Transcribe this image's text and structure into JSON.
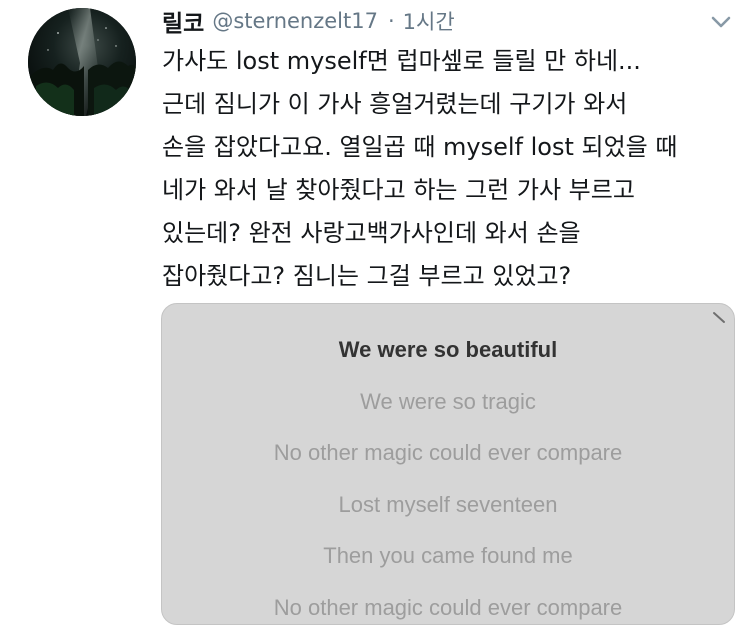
{
  "tweet": {
    "display_name": "릴코",
    "handle": "@sternenzelt17",
    "separator": "·",
    "time": "1시간",
    "lines": [
      "가사도 lost myself면 럽마셒로 들릴 만 하네...",
      "근데 짐니가 이 가사 흥얼거렸는데 구기가 와서",
      "손을 잡았다고요. 열일곱 때 myself lost 되었을 때",
      "네가 와서 날 찾아줬다고 하는 그런 가사 부르고",
      "있는데? 완전 사랑고백가사인데 와서 손을",
      "잡아줬다고? 짐니는 그걸 부르고 있었고?"
    ]
  },
  "media": {
    "lyrics": [
      "We were so beautiful",
      "We were so tragic",
      "No other magic could ever compare",
      "Lost myself seventeen",
      "Then you came found me",
      "No other magic could ever compare"
    ]
  },
  "icons": {
    "caret": "chevron-down-icon",
    "avatar": "avatar"
  },
  "colors": {
    "secondary_text": "#657786",
    "media_background": "#d6d6d6",
    "lyric_current": "#333333",
    "lyric_other": "#9d9d9d"
  }
}
